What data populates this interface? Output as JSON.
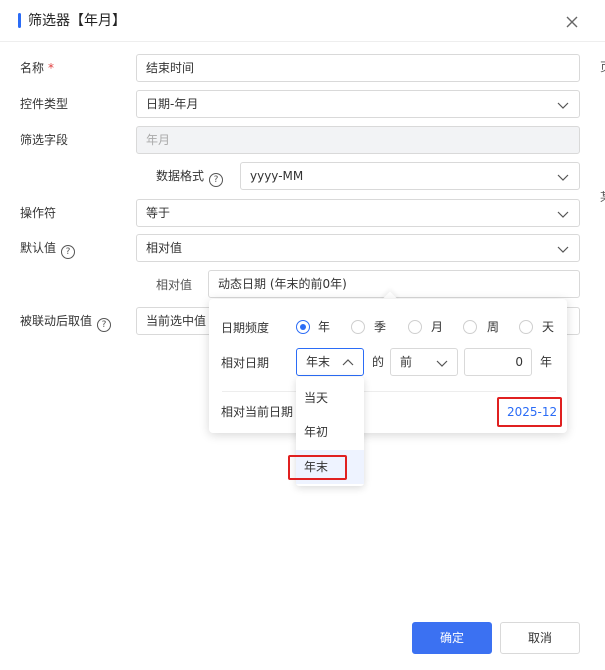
{
  "dialog": {
    "title": "筛选器【年月】",
    "close_label": "×"
  },
  "form": {
    "name_label": "名称",
    "required_mark": "*",
    "name_value": "结束时间",
    "control_type_label": "控件类型",
    "control_type_value": "日期-年月",
    "filter_field_label": "筛选字段",
    "filter_field_placeholder": "年月",
    "data_format_label": "数据格式",
    "data_format_value": "yyyy-MM",
    "operator_label": "操作符",
    "operator_value": "等于",
    "default_label": "默认值",
    "default_value": "相对值",
    "relative_label": "相对值",
    "relative_value": "动态日期 (年末的前0年)",
    "linked_label": "被联动后取值",
    "linked_value": "当前选中值",
    "help_glyph": "?"
  },
  "popover": {
    "frequency_label": "日期频度",
    "frequency_options": [
      "年",
      "季",
      "月",
      "周",
      "天"
    ],
    "frequency_selected": "年",
    "relative_date_label": "相对日期",
    "anchor_value": "年末",
    "of_text": "的",
    "direction_value": "前",
    "offset_value": "0",
    "unit_text": "年",
    "relative_current_label": "相对当前日期",
    "result_value": "2025-12"
  },
  "anchor_dropdown": {
    "options": [
      "当天",
      "年初",
      "年末"
    ],
    "selected": "年末"
  },
  "footer": {
    "confirm_label": "确定",
    "cancel_label": "取消"
  },
  "right_edge": {
    "clip_1": "页",
    "clip_2": "某"
  },
  "colors": {
    "accent": "#2b6cf6",
    "primary_button": "#3b71f2",
    "highlight_red": "#e02020",
    "disabled_bg": "#f2f3f5"
  }
}
